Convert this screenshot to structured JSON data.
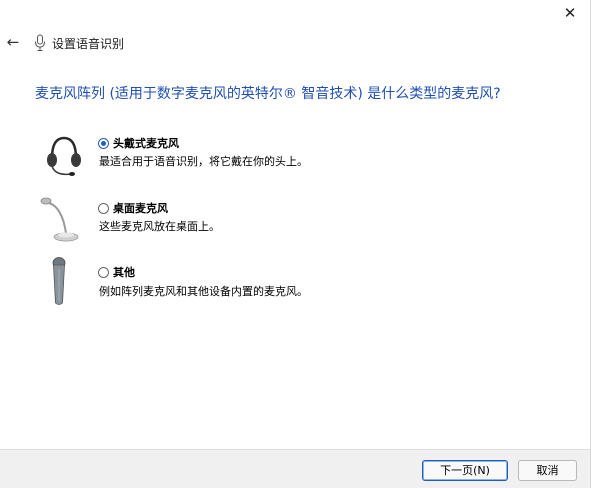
{
  "window": {
    "close_glyph": "✕"
  },
  "header": {
    "back_glyph": "←",
    "title": "设置语音识别"
  },
  "question": "麦克风阵列 (适用于数字麦克风的英特尔® 智音技术) 是什么类型的麦克风?",
  "options": [
    {
      "label": "头戴式麦克风",
      "description": "最适合用于语音识别，将它戴在你的头上。",
      "selected": true,
      "icon": "headset-icon"
    },
    {
      "label": "桌面麦克风",
      "description": "这些麦克风放在桌面上。",
      "selected": false,
      "icon": "desktop-microphone-icon"
    },
    {
      "label": "其他",
      "description": "例如阵列麦克风和其他设备内置的麦克风。",
      "selected": false,
      "icon": "handheld-microphone-icon"
    }
  ],
  "footer": {
    "next_label": "下一页(N)",
    "cancel_label": "取消"
  },
  "colors": {
    "accent": "#1f4fb5",
    "footer_bg": "#f0f0f0"
  }
}
